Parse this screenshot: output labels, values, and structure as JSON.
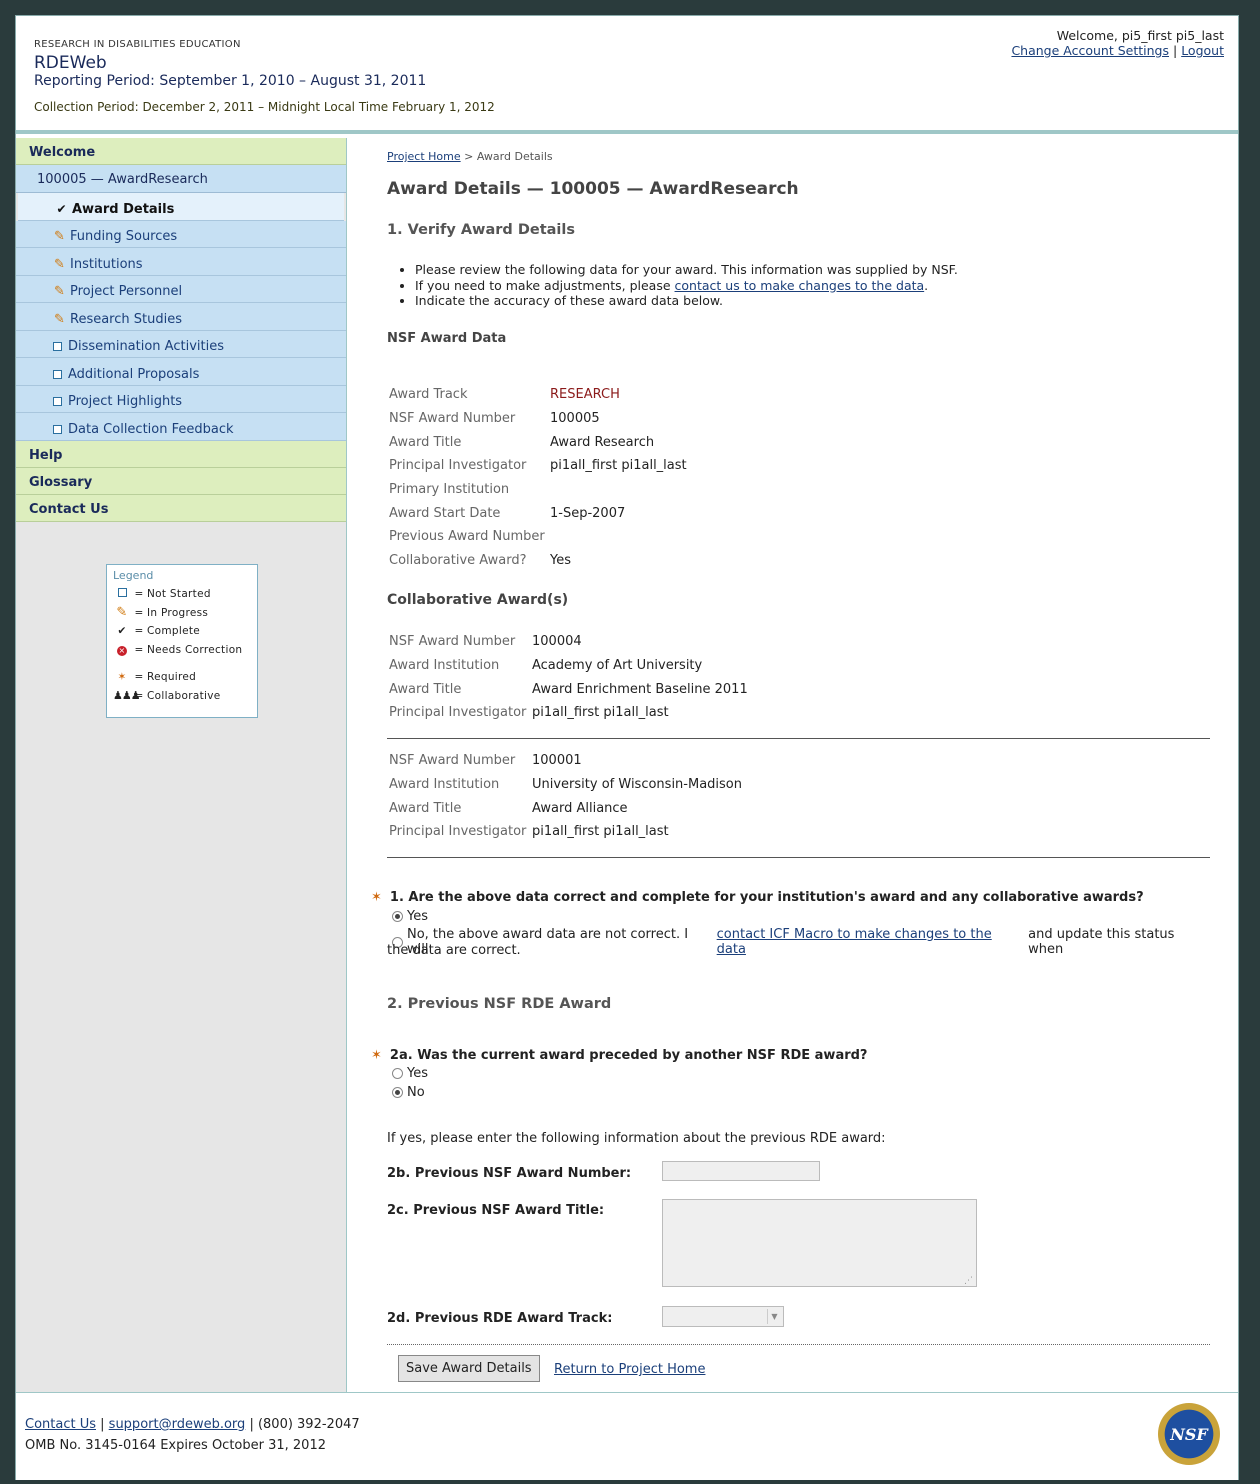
{
  "header": {
    "org": "RESEARCH IN DISABILITIES EDUCATION",
    "app": "RDEWeb",
    "reporting_period": "Reporting Period: September 1, 2010 – August 31, 2011",
    "collection_period": "Collection Period: December 2, 2011 – Midnight Local Time February 1, 2012",
    "welcome": "Welcome, pi5_first pi5_last",
    "change_settings": "Change Account Settings",
    "separator": "|",
    "logout": "Logout"
  },
  "sidebar": {
    "welcome": "Welcome",
    "award": "100005 — AwardResearch",
    "items": [
      {
        "label": "Award Details",
        "status": "complete"
      },
      {
        "label": "Funding Sources",
        "status": "in-progress"
      },
      {
        "label": "Institutions",
        "status": "in-progress"
      },
      {
        "label": "Project Personnel",
        "status": "in-progress"
      },
      {
        "label": "Research Studies",
        "status": "in-progress"
      },
      {
        "label": "Dissemination Activities",
        "status": "not-started"
      },
      {
        "label": "Additional Proposals",
        "status": "not-started"
      },
      {
        "label": "Project Highlights",
        "status": "not-started"
      },
      {
        "label": "Data Collection Feedback",
        "status": "not-started"
      }
    ],
    "help": "Help",
    "glossary": "Glossary",
    "contact": "Contact Us",
    "legend": {
      "title": "Legend",
      "eq": "=",
      "not_started": "Not Started",
      "in_progress": "In Progress",
      "complete": "Complete",
      "needs_correction": "Needs Correction",
      "required": "Required",
      "collaborative": "Collaborative"
    }
  },
  "main": {
    "crumb_home": "Project Home",
    "crumb_sep": ">",
    "crumb_current": "Award Details",
    "title": "Award Details — 100005 — AwardResearch",
    "section1": "1. Verify Award Details",
    "bullet1": "Please review the following data for your award. This information was supplied by NSF.",
    "bullet2_pre": "If you need to make adjustments, please",
    "bullet2_link": "contact us to make changes to the data",
    "bullet2_post": ".",
    "bullet3": "Indicate the accuracy of these award data below.",
    "nsf_award_data": "NSF Award Data",
    "award": {
      "track_label": "Award Track",
      "track": "RESEARCH",
      "number_label": "NSF Award Number",
      "number": "100005",
      "title_label": "Award Title",
      "title": "Award Research",
      "pi_label": "Principal Investigator",
      "pi": "pi1all_first pi1all_last",
      "inst_label": "Primary Institution",
      "inst": "",
      "start_label": "Award Start Date",
      "start": "1-Sep-2007",
      "prev_label": "Previous Award Number",
      "prev": "",
      "collab_label": "Collaborative Award?",
      "collab": "Yes"
    },
    "collab_heading": "Collaborative Award(s)",
    "collab_awards": [
      {
        "number_label": "NSF Award Number",
        "number": "100004",
        "inst_label": "Award Institution",
        "inst": "Academy of Art University",
        "title_label": "Award Title",
        "title": "Award Enrichment Baseline 2011",
        "pi_label": "Principal Investigator",
        "pi": "pi1all_first pi1all_last"
      },
      {
        "number_label": "NSF Award Number",
        "number": "100001",
        "inst_label": "Award Institution",
        "inst": "University of Wisconsin-Madison",
        "title_label": "Award Title",
        "title": "Award Alliance",
        "pi_label": "Principal Investigator",
        "pi": "pi1all_first pi1all_last"
      }
    ],
    "q1": "1. Are the above data correct and complete for your institution's award and any collaborative awards?",
    "q1_yes": "Yes",
    "q1_no_pre": "No, the above award data are not correct. I will",
    "q1_no_link": "contact ICF Macro to make changes to the data",
    "q1_no_post": "and update this status when",
    "q1_no_cont": "the data are correct.",
    "section2": "2. Previous NSF RDE Award",
    "q2a": "2a. Was the current award preceded by another NSF RDE award?",
    "q2a_yes": "Yes",
    "q2a_no": "No",
    "ifyes": "If yes, please enter the following information about the previous RDE award:",
    "q2b": "2b. Previous NSF Award Number:",
    "q2c": "2c. Previous NSF Award Title:",
    "q2d": "2d. Previous RDE Award Track:",
    "save": "Save Award Details",
    "return": "Return to Project Home"
  },
  "footer": {
    "contact": "Contact Us",
    "sep": "|",
    "email": "support@rdeweb.org",
    "phone": "| (800) 392-2047",
    "omb": "OMB No. 3145-0164 Expires October 31, 2012",
    "logo_text": "NSF"
  }
}
